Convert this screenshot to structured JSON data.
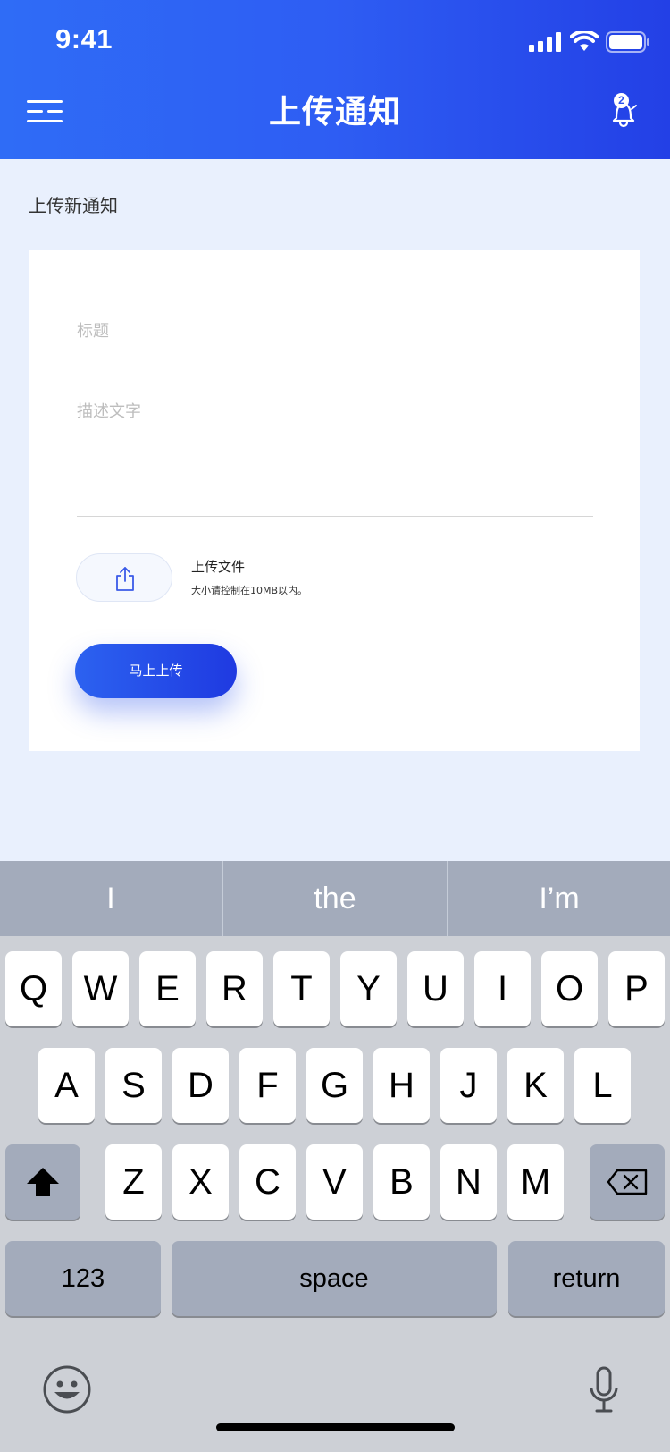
{
  "status_bar": {
    "time": "9:41"
  },
  "header": {
    "title": "上传通知",
    "notification_count": "2"
  },
  "section": {
    "title": "上传新通知"
  },
  "form": {
    "title_placeholder": "标题",
    "description_placeholder": "描述文字",
    "upload_label": "上传文件",
    "upload_hint": "大小请控制在10MB以内。",
    "submit_label": "马上上传"
  },
  "keyboard": {
    "suggestions": [
      "I",
      "the",
      "I’m"
    ],
    "row1": [
      "Q",
      "W",
      "E",
      "R",
      "T",
      "Y",
      "U",
      "I",
      "O",
      "P"
    ],
    "row2": [
      "A",
      "S",
      "D",
      "F",
      "G",
      "H",
      "J",
      "K",
      "L"
    ],
    "row3": [
      "Z",
      "X",
      "C",
      "V",
      "B",
      "N",
      "M"
    ],
    "numbers_label": "123",
    "space_label": "space",
    "return_label": "return"
  }
}
